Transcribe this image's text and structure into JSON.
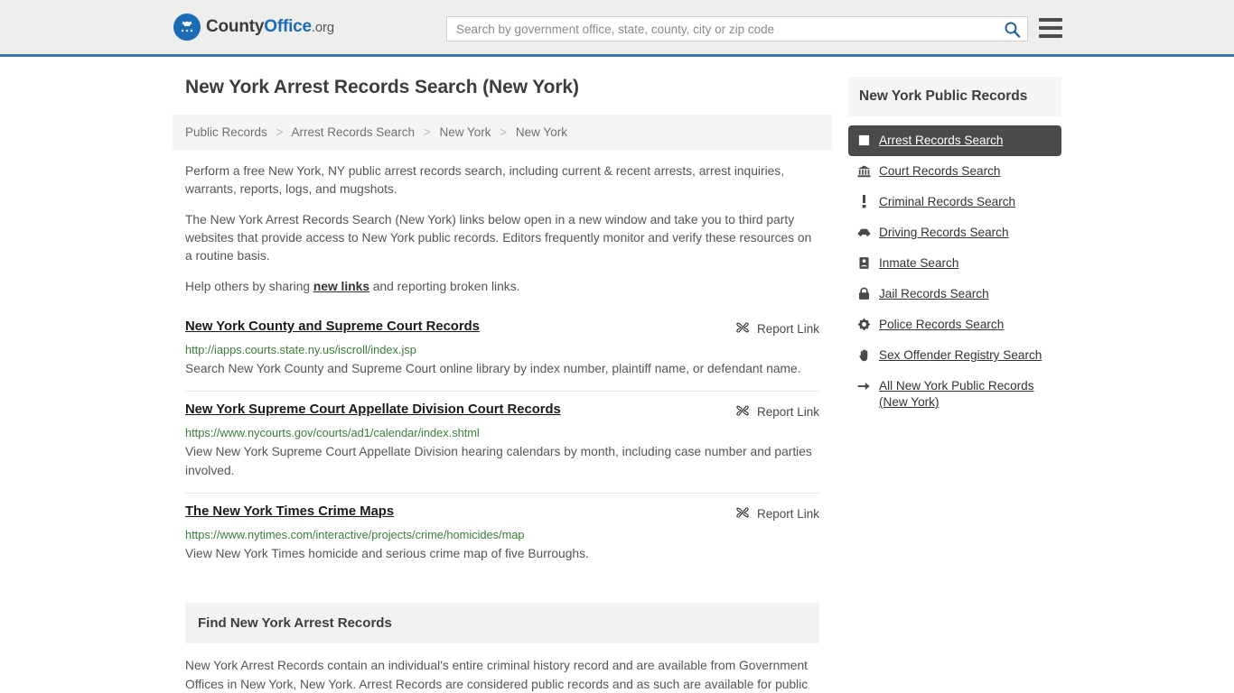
{
  "header": {
    "logo": {
      "county": "County",
      "office": "Office",
      "org": ".org",
      "icon": "eagle-seal-icon"
    },
    "search": {
      "placeholder": "Search by government office, state, county, city or zip code",
      "value": "",
      "button_icon": "search-icon"
    },
    "menu_icon": "hamburger-menu-icon",
    "accent_color": "#3a77a6"
  },
  "main": {
    "title": "New York Arrest Records Search (New York)",
    "breadcrumb": [
      "Public Records",
      "Arrest Records Search",
      "New York",
      "New York"
    ],
    "breadcrumb_separator": ">",
    "intro": [
      "Perform a free New York, NY public arrest records search, including current & recent arrests, arrest inquiries, warrants, reports, logs, and mugshots.",
      "The New York Arrest Records Search (New York) links below open in a new window and take you to third party websites that provide access to New York public records. Editors frequently monitor and verify these resources on a routine basis."
    ],
    "help_prefix": "Help others by sharing ",
    "help_link": "new links",
    "help_suffix": " and reporting broken links.",
    "report_link_label": "Report Link",
    "report_link_icon": "broken-link-icon",
    "links": [
      {
        "title": "New York County and Supreme Court Records",
        "url": "http://iapps.courts.state.ny.us/iscroll/index.jsp",
        "description": "Search New York County and Supreme Court online library by index number, plaintiff name, or defendant name."
      },
      {
        "title": "New York Supreme Court Appellate Division Court Records",
        "url": "https://www.nycourts.gov/courts/ad1/calendar/index.shtml",
        "description": "View New York Supreme Court Appellate Division hearing calendars by month, including case number and parties involved."
      },
      {
        "title": "The New York Times Crime Maps",
        "url": "https://www.nytimes.com/interactive/projects/crime/homicides/map",
        "description": "View New York Times homicide and serious crime map of five Burroughs."
      }
    ],
    "find_section": {
      "heading": "Find New York Arrest Records",
      "body": "New York Arrest Records contain an individual's entire criminal history record and are available from Government Offices in New York, New York. Arrest Records are considered public records and as such are available for public"
    }
  },
  "sidebar": {
    "title": "New York Public Records",
    "active_bg": "#4a4a4a",
    "items": [
      {
        "label": "Arrest Records Search",
        "icon": "square-badge-icon",
        "active": true
      },
      {
        "label": "Court Records Search",
        "icon": "courthouse-icon",
        "active": false
      },
      {
        "label": "Criminal Records Search",
        "icon": "exclamation-icon",
        "active": false
      },
      {
        "label": "Driving Records Search",
        "icon": "car-icon",
        "active": false
      },
      {
        "label": "Inmate Search",
        "icon": "id-card-icon",
        "active": false
      },
      {
        "label": "Jail Records Search",
        "icon": "lock-icon",
        "active": false
      },
      {
        "label": "Police Records Search",
        "icon": "police-badge-icon",
        "active": false
      },
      {
        "label": "Sex Offender Registry Search",
        "icon": "hand-icon",
        "active": false
      },
      {
        "label": "All New York Public Records (New York)",
        "icon": "arrow-right-icon",
        "active": false
      }
    ]
  }
}
